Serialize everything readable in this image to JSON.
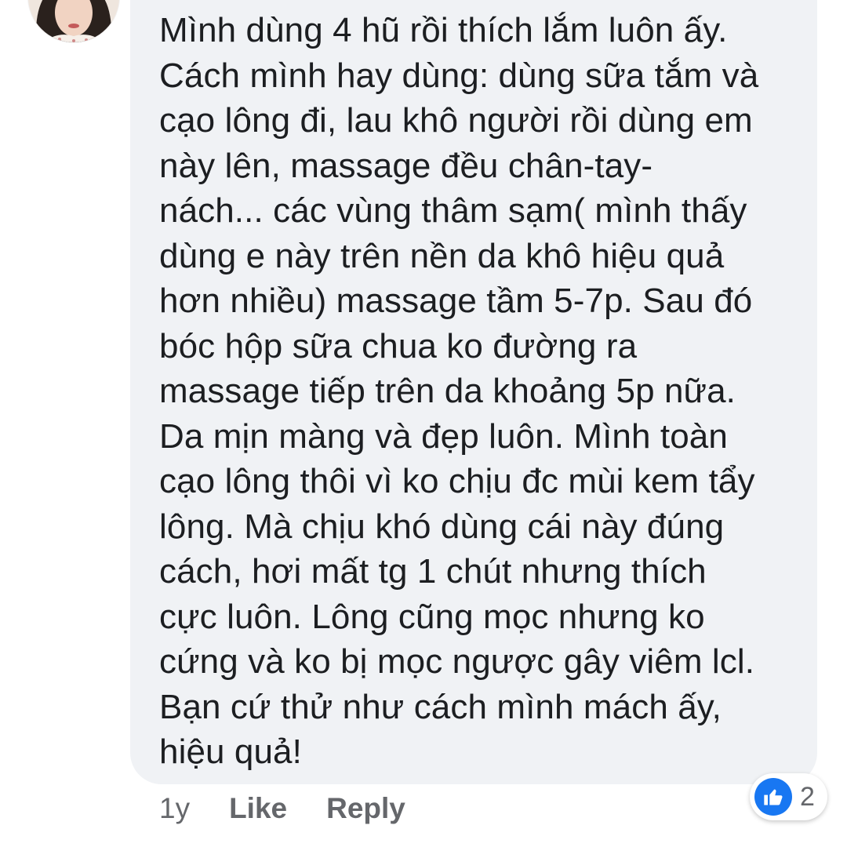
{
  "comment": {
    "lines": [
      "Mình dùng 4 hũ rồi thích lắm luôn ấy.",
      "Cách mình hay dùng: dùng sữa tắm và",
      "cạo lông đi, lau khô người rồi dùng em",
      "này lên, massage đều chân-tay-",
      "nách... các vùng thâm sạm( mình thấy",
      "dùng e này trên nền da khô hiệu quả",
      "hơn nhiều) massage tầm 5-7p. Sau đó",
      "bóc hộp sữa chua ko đường ra",
      "massage tiếp trên da khoảng 5p nữa.",
      "Da mịn màng và đẹp luôn. Mình toàn",
      "cạo lông thôi vì ko chịu đc mùi kem tẩy",
      "lông. Mà chịu khó dùng cái này đúng",
      "cách, hơi mất tg 1 chút nhưng thích",
      "cực luôn. Lông cũng mọc nhưng ko",
      "cứng và ko bị mọc ngược gây viêm lcl.",
      "Bạn cứ thử như cách mình mách ấy,",
      "hiệu quả!"
    ]
  },
  "actions": {
    "time": "1y",
    "like": "Like",
    "reply": "Reply"
  },
  "reactions": {
    "icon": "thumbs-up-icon",
    "count": "2"
  },
  "colors": {
    "bubble": "#f0f2f5",
    "text": "#1c1e21",
    "meta": "#65676b",
    "like_blue": "#1877f2"
  }
}
